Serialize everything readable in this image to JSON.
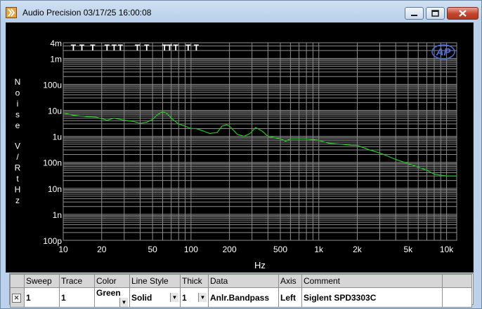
{
  "window": {
    "title": "Audio Precision  03/17/25 16:00:08"
  },
  "icons": {
    "app": "audio-precision-app-icon",
    "minimize": "minimize-icon",
    "maximize": "maximize-icon",
    "close": "close-icon",
    "logo": "ap-logo-icon"
  },
  "colors": {
    "plot_bg": "#000000",
    "grid": "#8c8c8c",
    "trace": "#1ec81e",
    "text": "#ffffff"
  },
  "chart_data": {
    "type": "line",
    "xlabel": "Hz",
    "ylabel": "Noise V/RtHz",
    "xscale": "log",
    "yscale": "log",
    "xlim": [
      10,
      12000
    ],
    "ylim": [
      1e-10,
      0.004
    ],
    "x_tick_labels": [
      {
        "v": 10,
        "t": "10"
      },
      {
        "v": 20,
        "t": "20"
      },
      {
        "v": 50,
        "t": "50"
      },
      {
        "v": 100,
        "t": "100"
      },
      {
        "v": 200,
        "t": "200"
      },
      {
        "v": 500,
        "t": "500"
      },
      {
        "v": 1000,
        "t": "1k"
      },
      {
        "v": 2000,
        "t": "2k"
      },
      {
        "v": 5000,
        "t": "5k"
      },
      {
        "v": 10000,
        "t": "10k"
      }
    ],
    "y_tick_labels": [
      {
        "v": 0.004,
        "t": "4m"
      },
      {
        "v": 0.001,
        "t": "1m"
      },
      {
        "v": 0.0001,
        "t": "100u"
      },
      {
        "v": 1e-05,
        "t": "10u"
      },
      {
        "v": 1e-06,
        "t": "1u"
      },
      {
        "v": 1e-07,
        "t": "100n"
      },
      {
        "v": 1e-08,
        "t": "10n"
      },
      {
        "v": 1e-09,
        "t": "1n"
      },
      {
        "v": 1e-10,
        "t": "100p"
      }
    ],
    "markers_x": [
      12,
      14,
      17,
      22,
      25,
      28,
      38,
      45,
      62,
      68,
      76,
      95,
      110
    ],
    "marker_label": "T",
    "series": [
      {
        "color": "#1ec81e",
        "x": [
          10,
          12,
          15,
          18,
          20,
          22,
          25,
          30,
          35,
          40,
          45,
          50,
          55,
          60,
          65,
          70,
          80,
          90,
          100,
          110,
          125,
          140,
          160,
          175,
          190,
          200,
          230,
          260,
          290,
          320,
          360,
          400,
          450,
          500,
          550,
          600,
          700,
          800,
          1000,
          1200,
          1500,
          1800,
          2000,
          2500,
          3000,
          4000,
          5000,
          6000,
          7000,
          8000,
          10000,
          12000
        ],
        "y": [
          8e-06,
          6.5e-06,
          5.8e-06,
          5.5e-06,
          4.8e-06,
          4.2e-06,
          5e-06,
          4.2e-06,
          3.8e-06,
          3.2e-06,
          3.5e-06,
          4.5e-06,
          7e-06,
          9e-06,
          7.5e-06,
          5e-06,
          3e-06,
          2.5e-06,
          2e-06,
          2e-06,
          1.6e-06,
          1.3e-06,
          1.4e-06,
          2.5e-06,
          2.8e-06,
          2.5e-06,
          1.2e-06,
          1e-06,
          1.3e-06,
          2.2e-06,
          1.6e-06,
          1e-06,
          9e-07,
          8e-07,
          6.5e-07,
          8e-07,
          8e-07,
          8e-07,
          7e-07,
          5.5e-07,
          5e-07,
          4.5e-07,
          4.5e-07,
          3e-07,
          2.3e-07,
          1.3e-07,
          9e-08,
          6.5e-08,
          5e-08,
          3.5e-08,
          3e-08,
          3e-08
        ]
      }
    ]
  },
  "sweep_table": {
    "headers": [
      "Sweep",
      "Trace",
      "Color",
      "Line Style",
      "Thick",
      "Data",
      "Axis",
      "Comment"
    ],
    "rows": [
      {
        "sweep": "1",
        "trace": "1",
        "color": "Green",
        "line_style": "Solid",
        "thick": "1",
        "data": "Anlr.Bandpass",
        "axis": "Left",
        "comment": "Siglent SPD3303C"
      }
    ]
  }
}
